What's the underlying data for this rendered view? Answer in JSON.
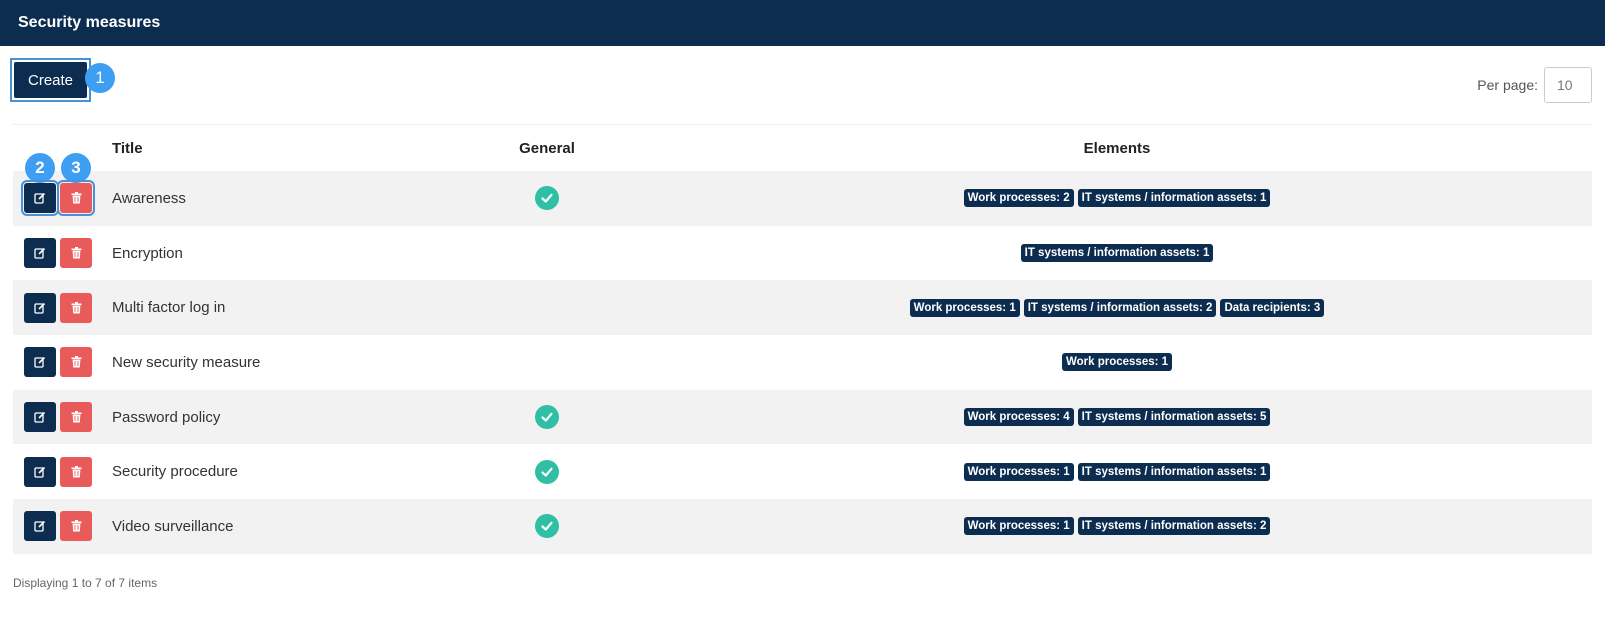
{
  "header": {
    "title": "Security measures"
  },
  "toolbar": {
    "create_label": "Create",
    "per_page_label": "Per page:",
    "per_page_value": "10"
  },
  "markers": [
    "1",
    "2",
    "3"
  ],
  "columns": {
    "title": "Title",
    "general": "General",
    "elements": "Elements"
  },
  "rows": [
    {
      "title": "Awareness",
      "general": true,
      "elements": [
        "Work processes: 2",
        "IT systems / information assets: 1"
      ]
    },
    {
      "title": "Encryption",
      "general": false,
      "elements": [
        "IT systems / information assets: 1"
      ]
    },
    {
      "title": "Multi factor log in",
      "general": false,
      "elements": [
        "Work processes: 1",
        "IT systems / information assets: 2",
        "Data recipients: 3"
      ]
    },
    {
      "title": "New security measure",
      "general": false,
      "elements": [
        "Work processes: 1"
      ]
    },
    {
      "title": "Password policy",
      "general": true,
      "elements": [
        "Work processes: 4",
        "IT systems / information assets: 5"
      ]
    },
    {
      "title": "Security procedure",
      "general": true,
      "elements": [
        "Work processes: 1",
        "IT systems / information assets: 1"
      ]
    },
    {
      "title": "Video surveillance",
      "general": true,
      "elements": [
        "Work processes: 1",
        "IT systems / information assets: 2"
      ]
    }
  ],
  "footer": {
    "status": "Displaying 1 to 7 of 7 items"
  },
  "colors": {
    "primary": "#0c2d50",
    "danger": "#e95a5a",
    "success": "#2fbfa5",
    "marker": "#3d9ef2"
  },
  "icons": {
    "edit": "edit-icon",
    "delete": "trash-icon",
    "general": "check-circle-icon"
  }
}
